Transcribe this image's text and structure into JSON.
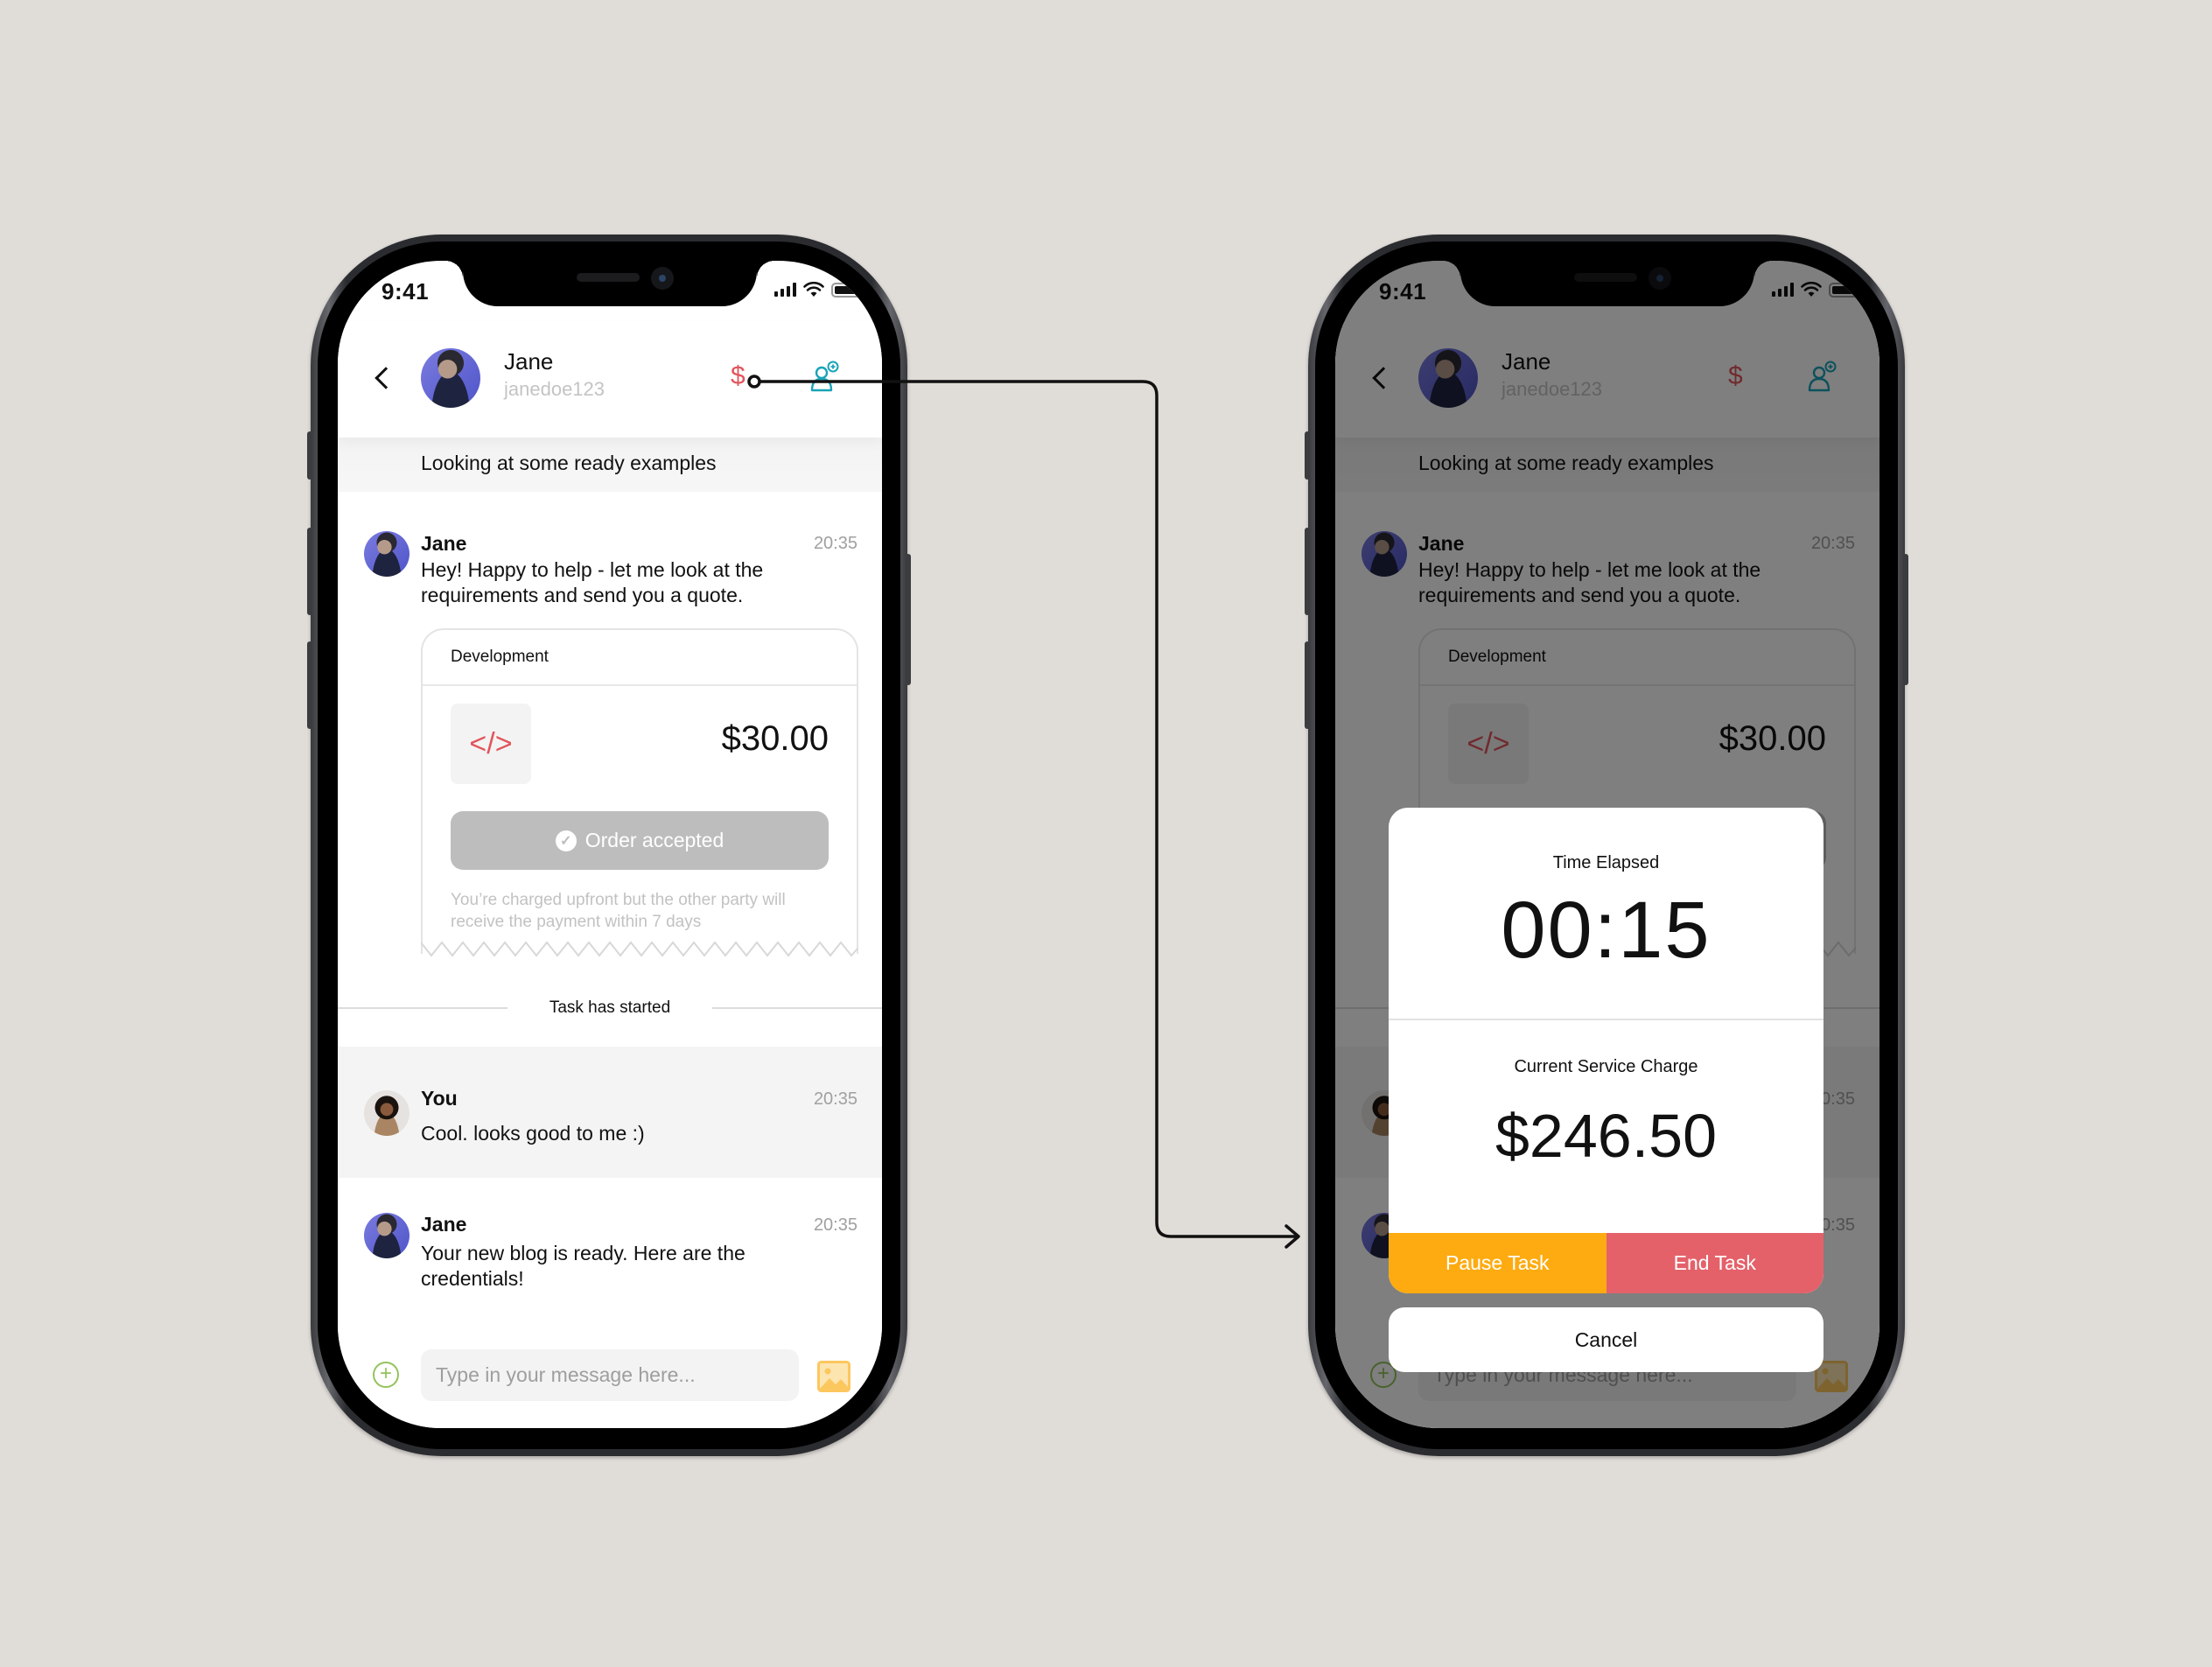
{
  "status_bar": {
    "time": "9:41"
  },
  "header": {
    "contact_name": "Jane",
    "contact_username": "janedoe123",
    "dollar_symbol": "$"
  },
  "messages": {
    "previous_partial": "Looking at some ready examples",
    "jane_1": {
      "sender": "Jane",
      "time": "20:35",
      "text": "Hey! Happy to help - let me look at the requirements and send you a quote."
    },
    "quote_card": {
      "title": "Development",
      "icon": "</>",
      "price": "$30.00",
      "status_label": "Order accepted",
      "check_glyph": "✓",
      "note": "You’re charged upfront but the other party will receive the payment within 7 days"
    },
    "system_event": "Task has started",
    "you_1": {
      "sender": "You",
      "time": "20:35",
      "text": "Cool. looks good to me :)"
    },
    "jane_2": {
      "sender": "Jane",
      "time": "20:35",
      "text": "Your new blog is ready. Here are the credentials!"
    }
  },
  "composer": {
    "placeholder": "Type in your message here...",
    "plus_glyph": "+"
  },
  "task_modal": {
    "time_label": "Time Elapsed",
    "time_value": "00:15",
    "charge_label": "Current Service Charge",
    "charge_value": "$246.50",
    "pause_label": "Pause Task",
    "end_label": "End Task",
    "cancel_label": "Cancel"
  },
  "colors": {
    "background": "#e0dcd8",
    "dollar_red": "#e2545c",
    "add_user_teal": "#1aa3b8",
    "pause_orange": "#fdab11",
    "end_red": "#e4616a",
    "plus_green": "#93c35c",
    "image_yellow": "#fcc75e"
  }
}
